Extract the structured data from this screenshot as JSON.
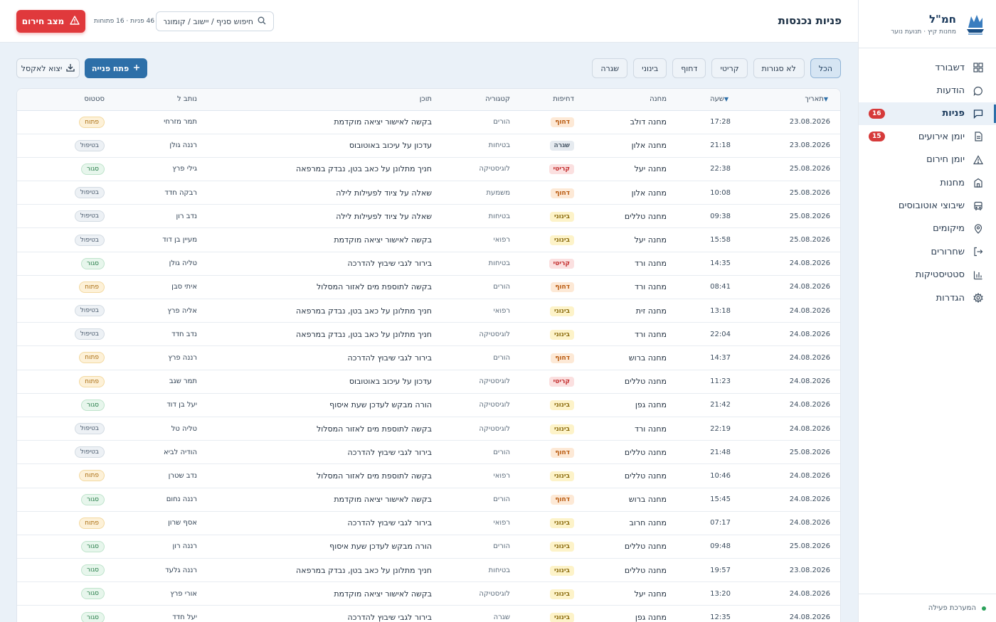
{
  "brand": {
    "name": "חמ\"ל",
    "subtitle": "מחנות קיץ · תנועת נוער"
  },
  "nav": [
    {
      "label": "דשבורד",
      "icon": "grid-icon"
    },
    {
      "label": "הודעות",
      "icon": "message-circle-icon"
    },
    {
      "label": "פניות",
      "icon": "message-square-icon",
      "badge": "16",
      "active": true
    },
    {
      "label": "יומן אירועים",
      "icon": "file-text-icon",
      "badge": "15"
    },
    {
      "label": "יומן חירום",
      "icon": "alert-triangle-icon"
    },
    {
      "label": "מחנות",
      "icon": "building-icon"
    },
    {
      "label": "שיבוצי אוטובוסים",
      "icon": "bus-icon"
    },
    {
      "label": "מיקומים",
      "icon": "map-pin-icon"
    },
    {
      "label": "שחרורים",
      "icon": "log-out-icon"
    },
    {
      "label": "סטטיסטיקות",
      "icon": "bar-chart-icon"
    },
    {
      "label": "הגדרות",
      "icon": "gear-icon"
    }
  ],
  "system_status": "המערכת פעילה",
  "header": {
    "title": "פניות נכנסות",
    "search_placeholder": "חיפוש סניף / יישוב / קומונרית",
    "counts": "46 פניות · 16 פתוחות",
    "emergency_label": "מצב חירום"
  },
  "filters": [
    "הכל",
    "לא סגורות",
    "קריטי",
    "דחוף",
    "בינוני",
    "שגרה"
  ],
  "active_filter": "הכל",
  "actions": {
    "open_ticket": "פתח פנייה",
    "export": "יצוא לאקסל"
  },
  "table": {
    "columns": {
      "date": "תאריך",
      "time": "שעה",
      "station": "מחנה",
      "urgency": "דחיפות",
      "category": "קטגוריה",
      "content": "תוכן",
      "user": "נותב ל",
      "status": "סטטוס"
    },
    "rows": [
      {
        "date": "23.08.2026",
        "time": "17:28",
        "station": "מחנה דולב",
        "urgency": "דחוף",
        "u": "urgent",
        "category": "הורים",
        "content": "בקשה לאישור יציאה מוקדמת",
        "user": "תמר מזרחי",
        "status": "פתוח",
        "s": "open"
      },
      {
        "date": "23.08.2026",
        "time": "21:18",
        "station": "מחנה אלון",
        "urgency": "שגרה",
        "u": "routine",
        "category": "בטיחות",
        "content": "עדכון על עיכוב באוטובוס",
        "user": "רננה גולן",
        "status": "בטיפול",
        "s": "progress"
      },
      {
        "date": "25.08.2026",
        "time": "22:38",
        "station": "מחנה יעל",
        "urgency": "קריטי",
        "u": "critical",
        "category": "לוגיסטיקה",
        "content": "חניך מתלונן על כאב בטן, נבדק במרפאה",
        "user": "גילי פרץ",
        "status": "סגור",
        "s": "closed"
      },
      {
        "date": "25.08.2026",
        "time": "10:08",
        "station": "מחנה אלון",
        "urgency": "דחוף",
        "u": "urgent",
        "category": "משמעת",
        "content": "שאלה על ציוד לפעילות לילה",
        "user": "רבקה חדד",
        "status": "בטיפול",
        "s": "progress"
      },
      {
        "date": "25.08.2026",
        "time": "09:38",
        "station": "מחנה טללים",
        "urgency": "בינוני",
        "u": "medium",
        "category": "בטיחות",
        "content": "שאלה על ציוד לפעילות לילה",
        "user": "נדב רון",
        "status": "בטיפול",
        "s": "progress"
      },
      {
        "date": "25.08.2026",
        "time": "15:58",
        "station": "מחנה יעל",
        "urgency": "בינוני",
        "u": "medium",
        "category": "רפואי",
        "content": "בקשה לאישור יציאה מוקדמת",
        "user": "מעיין בן דוד",
        "status": "בטיפול",
        "s": "progress"
      },
      {
        "date": "24.08.2026",
        "time": "14:35",
        "station": "מחנה ורד",
        "urgency": "קריטי",
        "u": "critical",
        "category": "בטיחות",
        "content": "בירור לגבי שיבוץ להדרכה",
        "user": "טליה גולן",
        "status": "סגור",
        "s": "closed"
      },
      {
        "date": "24.08.2026",
        "time": "08:41",
        "station": "מחנה ורד",
        "urgency": "דחוף",
        "u": "urgent",
        "category": "הורים",
        "content": "בקשה לתוספת מים לאזור המסלול",
        "user": "איתי סבן",
        "status": "פתוח",
        "s": "open"
      },
      {
        "date": "24.08.2026",
        "time": "13:18",
        "station": "מחנה זית",
        "urgency": "בינוני",
        "u": "medium",
        "category": "רפואי",
        "content": "חניך מתלונן על כאב בטן, נבדק במרפאה",
        "user": "אליה פרץ",
        "status": "בטיפול",
        "s": "progress"
      },
      {
        "date": "24.08.2026",
        "time": "22:04",
        "station": "מחנה ורד",
        "urgency": "בינוני",
        "u": "medium",
        "category": "לוגיסטיקה",
        "content": "חניך מתלונן על כאב בטן, נבדק במרפאה",
        "user": "נדב חדד",
        "status": "בטיפול",
        "s": "progress"
      },
      {
        "date": "24.08.2026",
        "time": "14:37",
        "station": "מחנה ברוש",
        "urgency": "דחוף",
        "u": "urgent",
        "category": "הורים",
        "content": "בירור לגבי שיבוץ להדרכה",
        "user": "רננה פרץ",
        "status": "פתוח",
        "s": "open"
      },
      {
        "date": "24.08.2026",
        "time": "11:23",
        "station": "מחנה טללים",
        "urgency": "קריטי",
        "u": "critical",
        "category": "לוגיסטיקה",
        "content": "עדכון על עיכוב באוטובוס",
        "user": "תמר שגב",
        "status": "פתוח",
        "s": "open"
      },
      {
        "date": "24.08.2026",
        "time": "21:42",
        "station": "מחנה גפן",
        "urgency": "בינוני",
        "u": "medium",
        "category": "לוגיסטיקה",
        "content": "הורה מבקש לעדכן שעת איסוף",
        "user": "יעל בן דוד",
        "status": "סגור",
        "s": "closed"
      },
      {
        "date": "24.08.2026",
        "time": "22:19",
        "station": "מחנה ורד",
        "urgency": "בינוני",
        "u": "medium",
        "category": "לוגיסטיקה",
        "content": "בקשה לתוספת מים לאזור המסלול",
        "user": "טליה טל",
        "status": "בטיפול",
        "s": "progress"
      },
      {
        "date": "25.08.2026",
        "time": "21:48",
        "station": "מחנה טללים",
        "urgency": "דחוף",
        "u": "urgent",
        "category": "הורים",
        "content": "בירור לגבי שיבוץ להדרכה",
        "user": "הודיה לביא",
        "status": "בטיפול",
        "s": "progress"
      },
      {
        "date": "24.08.2026",
        "time": "10:46",
        "station": "מחנה טללים",
        "urgency": "בינוני",
        "u": "medium",
        "category": "רפואי",
        "content": "בקשה לתוספת מים לאזור המסלול",
        "user": "נדב שטרן",
        "status": "פתוח",
        "s": "open"
      },
      {
        "date": "24.08.2026",
        "time": "15:45",
        "station": "מחנה ברוש",
        "urgency": "דחוף",
        "u": "urgent",
        "category": "הורים",
        "content": "בקשה לאישור יציאה מוקדמת",
        "user": "רננה נחום",
        "status": "סגור",
        "s": "closed"
      },
      {
        "date": "24.08.2026",
        "time": "07:17",
        "station": "מחנה חרוב",
        "urgency": "בינוני",
        "u": "medium",
        "category": "רפואי",
        "content": "בירור לגבי שיבוץ להדרכה",
        "user": "אסף שרון",
        "status": "פתוח",
        "s": "open"
      },
      {
        "date": "25.08.2026",
        "time": "09:48",
        "station": "מחנה טללים",
        "urgency": "בינוני",
        "u": "medium",
        "category": "הורים",
        "content": "הורה מבקש לעדכן שעת איסוף",
        "user": "רננה רון",
        "status": "סגור",
        "s": "closed"
      },
      {
        "date": "23.08.2026",
        "time": "19:57",
        "station": "מחנה טללים",
        "urgency": "בינוני",
        "u": "medium",
        "category": "בטיחות",
        "content": "חניך מתלונן על כאב בטן, נבדק במרפאה",
        "user": "רננה גלעד",
        "status": "סגור",
        "s": "closed"
      },
      {
        "date": "24.08.2026",
        "time": "13:20",
        "station": "מחנה יעל",
        "urgency": "בינוני",
        "u": "medium",
        "category": "לוגיסטיקה",
        "content": "בקשה לאישור יציאה מוקדמת",
        "user": "אורי פרץ",
        "status": "סגור",
        "s": "closed"
      },
      {
        "date": "24.08.2026",
        "time": "12:35",
        "station": "מחנה גפן",
        "urgency": "בינוני",
        "u": "medium",
        "category": "שגרה",
        "content": "בירור לגבי שיבוץ להדרכה",
        "user": "יעל חדד",
        "status": "סגור",
        "s": "closed"
      }
    ]
  },
  "colors": {
    "primary": "#2d6fa8",
    "danger": "#e0393c",
    "background": "#eaf1f8"
  }
}
